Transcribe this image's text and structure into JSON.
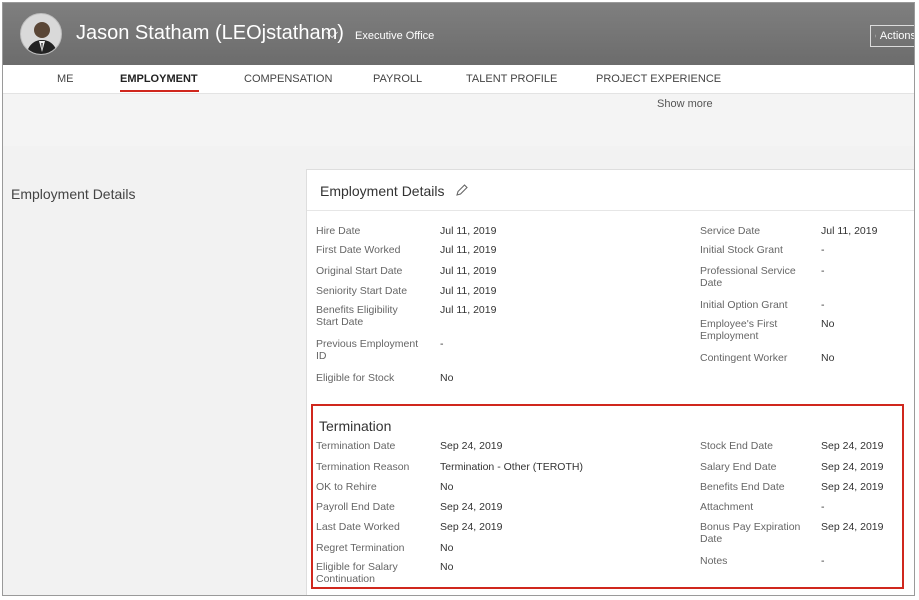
{
  "header": {
    "name": "Jason Statham (LEOjstatham)",
    "department": "Executive Office",
    "actions_label": "Actions"
  },
  "tabs": [
    "ME",
    "EMPLOYMENT",
    "COMPENSATION",
    "PAYROLL",
    "TALENT PROFILE",
    "PROJECT EXPERIENCE"
  ],
  "active_tab": "EMPLOYMENT",
  "show_more": "Show more",
  "section_heading": "Employment Details",
  "card": {
    "title": "Employment Details",
    "left_fields": [
      {
        "label": "Hire Date",
        "value": "Jul 11, 2019"
      },
      {
        "label": "First Date Worked",
        "value": "Jul 11, 2019"
      },
      {
        "label": "Original Start Date",
        "value": "Jul 11, 2019"
      },
      {
        "label": "Seniority Start Date",
        "value": "Jul 11, 2019"
      },
      {
        "label": "Benefits Eligibility Start Date",
        "value": "Jul 11, 2019"
      },
      {
        "label": "Previous Employment ID",
        "value": "-"
      },
      {
        "label": "Eligible for Stock",
        "value": "No"
      }
    ],
    "right_fields": [
      {
        "label": "Service Date",
        "value": "Jul 11, 2019"
      },
      {
        "label": "Initial Stock Grant",
        "value": "-"
      },
      {
        "label": "Professional Service Date",
        "value": "-"
      },
      {
        "label": "Initial Option Grant",
        "value": "-"
      },
      {
        "label": "Employee's First Employment",
        "value": "No"
      },
      {
        "label": "Contingent Worker",
        "value": "No"
      }
    ]
  },
  "termination": {
    "title": "Termination",
    "left_fields": [
      {
        "label": "Termination Date",
        "value": "Sep 24, 2019"
      },
      {
        "label": "Termination Reason",
        "value": "Termination - Other (TEROTH)"
      },
      {
        "label": "OK to Rehire",
        "value": "No"
      },
      {
        "label": "Payroll End Date",
        "value": "Sep 24, 2019"
      },
      {
        "label": "Last Date Worked",
        "value": "Sep 24, 2019"
      },
      {
        "label": "Regret Termination",
        "value": "No"
      },
      {
        "label": "Eligible for Salary Continuation",
        "value": "No"
      }
    ],
    "right_fields": [
      {
        "label": "Stock End Date",
        "value": "Sep 24, 2019"
      },
      {
        "label": "Salary End Date",
        "value": "Sep 24, 2019"
      },
      {
        "label": "Benefits End Date",
        "value": "Sep 24, 2019"
      },
      {
        "label": "Attachment",
        "value": "-"
      },
      {
        "label": "Bonus Pay Expiration Date",
        "value": "Sep 24, 2019"
      },
      {
        "label": "Notes",
        "value": "-"
      }
    ]
  },
  "colors": {
    "accent": "#d0271d",
    "header_bg": "#767676"
  },
  "icons": {
    "avatar": "user-photo",
    "name_dropdown": "chevron-down-icon",
    "edit": "pencil-icon",
    "actions": "more-vertical-icon"
  }
}
